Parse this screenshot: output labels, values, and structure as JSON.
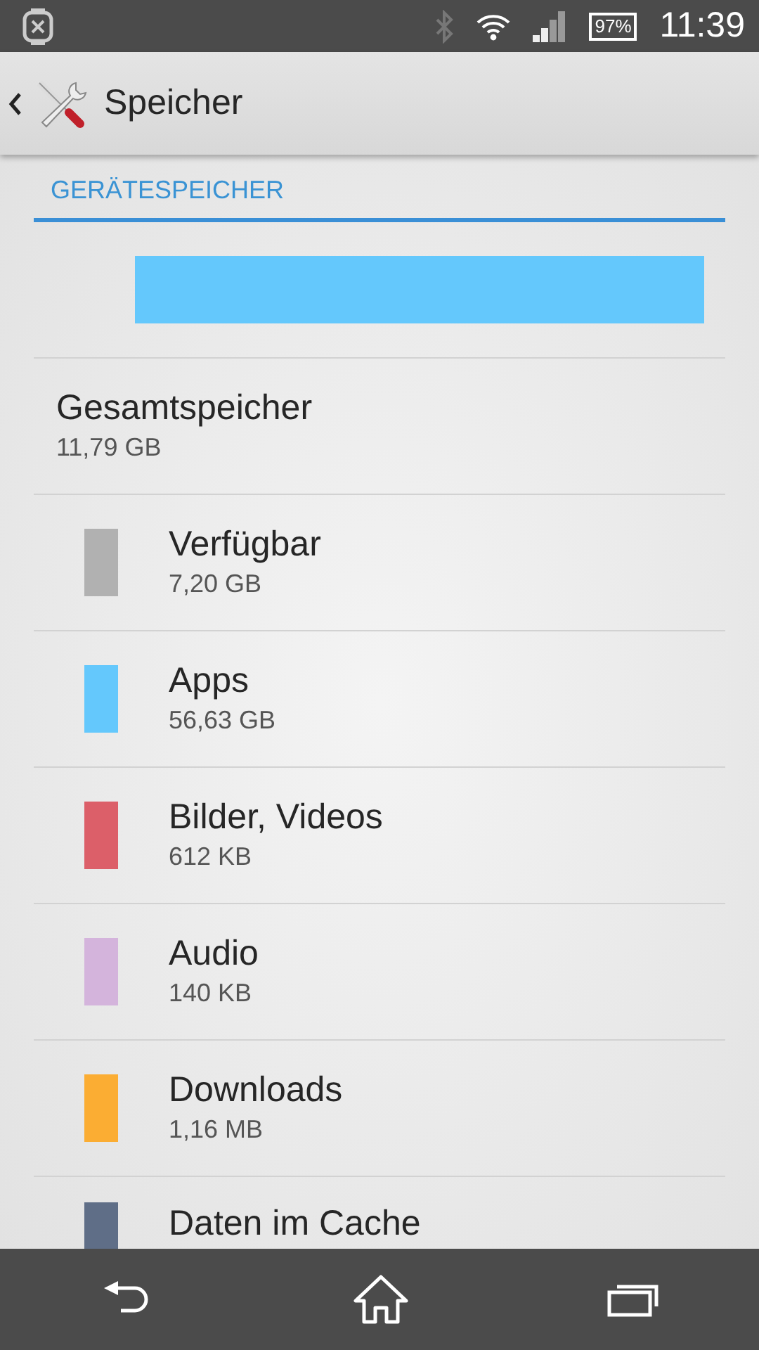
{
  "status_bar": {
    "battery": "97%",
    "time": "11:39"
  },
  "action_bar": {
    "title": "Speicher"
  },
  "section": {
    "title": "GERÄTESPEICHER"
  },
  "total": {
    "label": "Gesamtspeicher",
    "value": "11,79 GB"
  },
  "items": [
    {
      "label": "Verfügbar",
      "value": "7,20 GB",
      "color": "#b1b1b1"
    },
    {
      "label": "Apps",
      "value": "56,63 GB",
      "color": "#64c8fc"
    },
    {
      "label": "Bilder, Videos",
      "value": "612 KB",
      "color": "#dc5f69"
    },
    {
      "label": "Audio",
      "value": "140 KB",
      "color": "#d4b4dc"
    },
    {
      "label": "Downloads",
      "value": "1,16 MB",
      "color": "#fbad33"
    },
    {
      "label": "Daten im Cache",
      "color": "#5f6e87"
    }
  ]
}
